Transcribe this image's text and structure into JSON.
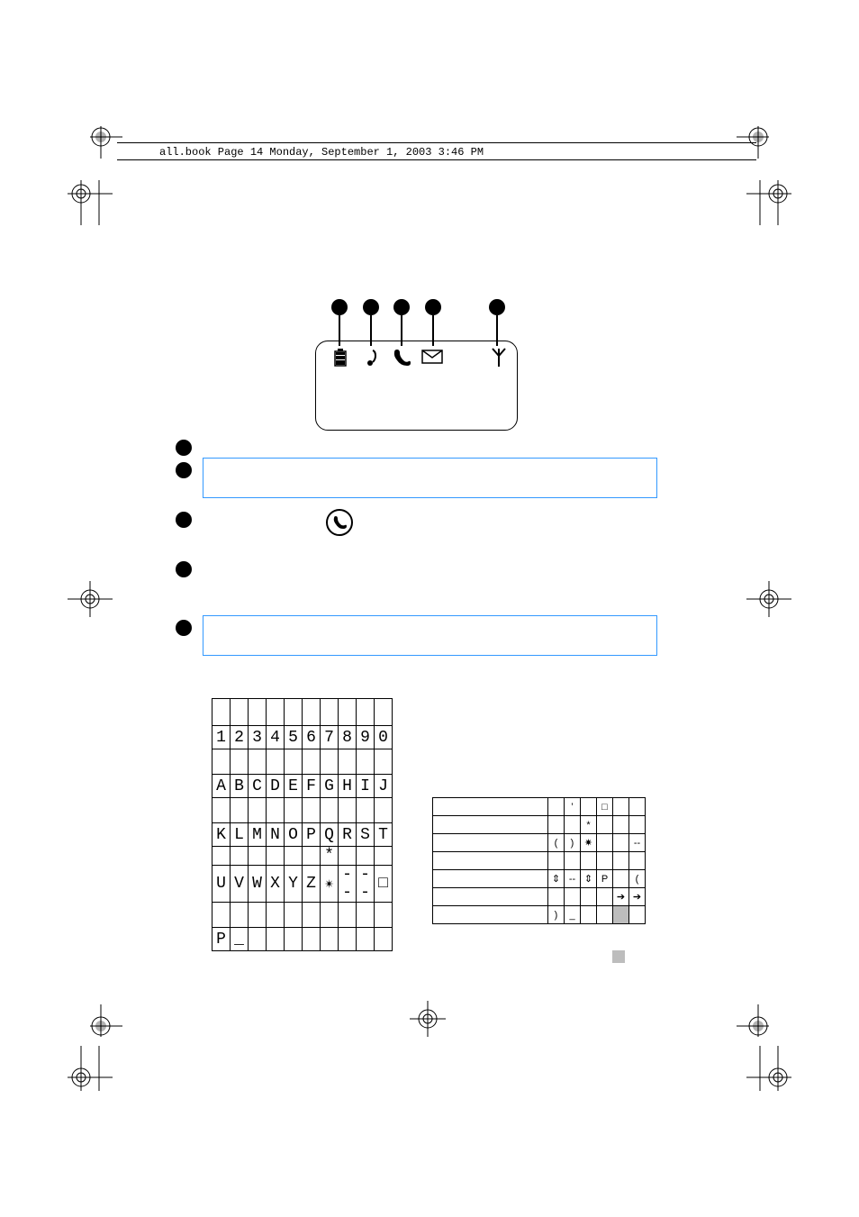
{
  "header": {
    "text": "all.book  Page 14  Monday, September 1, 2003  3:46 PM"
  },
  "icons": {
    "i1": "battery-icon",
    "i2": "note-icon",
    "i3": "handset-icon",
    "i4": "envelope-icon",
    "i5": "antenna-icon"
  },
  "char_rows": {
    "r1": [
      "1",
      "2",
      "3",
      "4",
      "5",
      "6",
      "7",
      "8",
      "9",
      "0"
    ],
    "r2": [
      "A",
      "B",
      "C",
      "D",
      "E",
      "F",
      "G",
      "H",
      "I",
      "J"
    ],
    "r3": [
      "K",
      "L",
      "M",
      "N",
      "O",
      "P",
      "Q",
      "R",
      "S",
      "T"
    ],
    "r4": [
      "",
      "",
      "",
      "",
      "",
      "",
      "*",
      "",
      "",
      ""
    ],
    "r5": [
      "U",
      "V",
      "W",
      "X",
      "Y",
      "Z",
      "✴",
      "--",
      "--",
      "□"
    ],
    "r6": [
      "P",
      "_",
      "",
      "",
      "",
      "",
      "",
      "",
      "",
      ""
    ]
  },
  "sym": {
    "c01_0": "’",
    "c03_0": "□",
    "c02_1": "*",
    "c00_2": "(",
    "c01_2": ")",
    "c02_2": "✷",
    "c05_2": "--",
    "c00_3": "⇕",
    "c01_3": "--",
    "c02_3": "⇕",
    "c03_3": "P",
    "c05_3": "(",
    "c04_4": "➔",
    "c05_4": "➔",
    "c00_5": ")",
    "c01_5": "_"
  }
}
